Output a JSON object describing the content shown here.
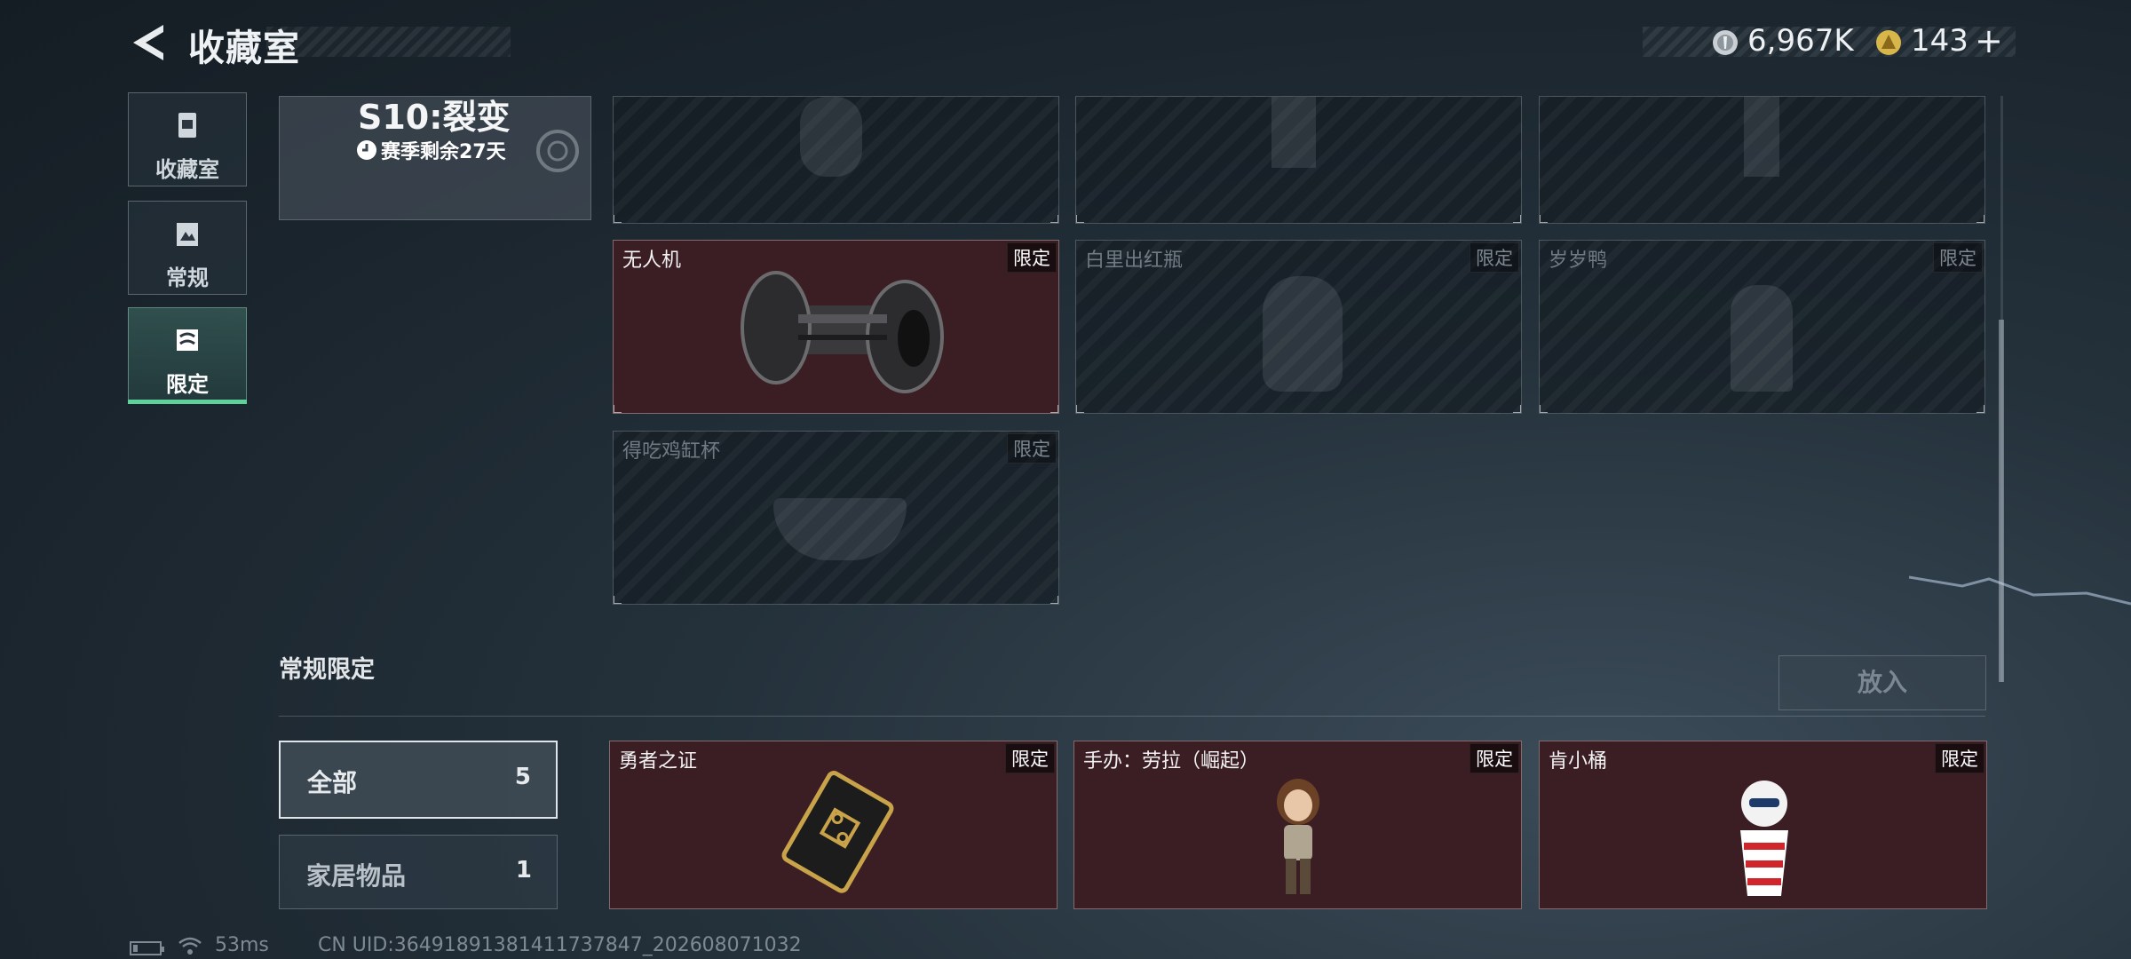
{
  "header": {
    "title": "收藏室",
    "currency": [
      {
        "icon": "silver-coin-icon",
        "value": "6,967K"
      },
      {
        "icon": "gold-coin-icon",
        "value": "143"
      }
    ],
    "add_label": "+"
  },
  "nav": {
    "items": [
      {
        "label": "收藏室",
        "icon": "collection-icon",
        "active": false
      },
      {
        "label": "常规",
        "icon": "regular-icon",
        "active": false
      },
      {
        "label": "限定",
        "icon": "limited-icon",
        "active": true
      }
    ]
  },
  "season": {
    "title": "S10:裂变",
    "timer": "赛季剩余27天"
  },
  "grid": {
    "cards": [
      {
        "name": "",
        "tag": "",
        "owned": false
      },
      {
        "name": "",
        "tag": "",
        "owned": false
      },
      {
        "name": "",
        "tag": "",
        "owned": false
      },
      {
        "name": "无人机",
        "tag": "限定",
        "owned": true,
        "art": "drone-part-image"
      },
      {
        "name": "白里出红瓶",
        "tag": "限定",
        "owned": false,
        "art": "vase-image"
      },
      {
        "name": "岁岁鸭",
        "tag": "限定",
        "owned": false,
        "art": "duck-image"
      },
      {
        "name": "得吃鸡缸杯",
        "tag": "限定",
        "owned": false,
        "art": "bowl-image"
      }
    ]
  },
  "section2": {
    "title": "常规限定",
    "put_label": "放入",
    "filters": [
      {
        "label": "全部",
        "count": "5",
        "active": true
      },
      {
        "label": "家居物品",
        "count": "1",
        "active": false
      }
    ],
    "cards": [
      {
        "name": "勇者之证",
        "tag": "限定",
        "owned": true,
        "art": "card-badge-image"
      },
      {
        "name": "手办：劳拉（崛起）",
        "tag": "限定",
        "owned": true,
        "art": "lara-figure-image"
      },
      {
        "name": "肯小桶",
        "tag": "限定",
        "owned": true,
        "art": "kfc-figure-image"
      }
    ]
  },
  "status": {
    "ping": "53ms",
    "uid": "CN UID:3649189138141173784​7_202608071032"
  },
  "colors": {
    "owned_card": "#3a1e24",
    "active_bar": "#5ed19a"
  }
}
